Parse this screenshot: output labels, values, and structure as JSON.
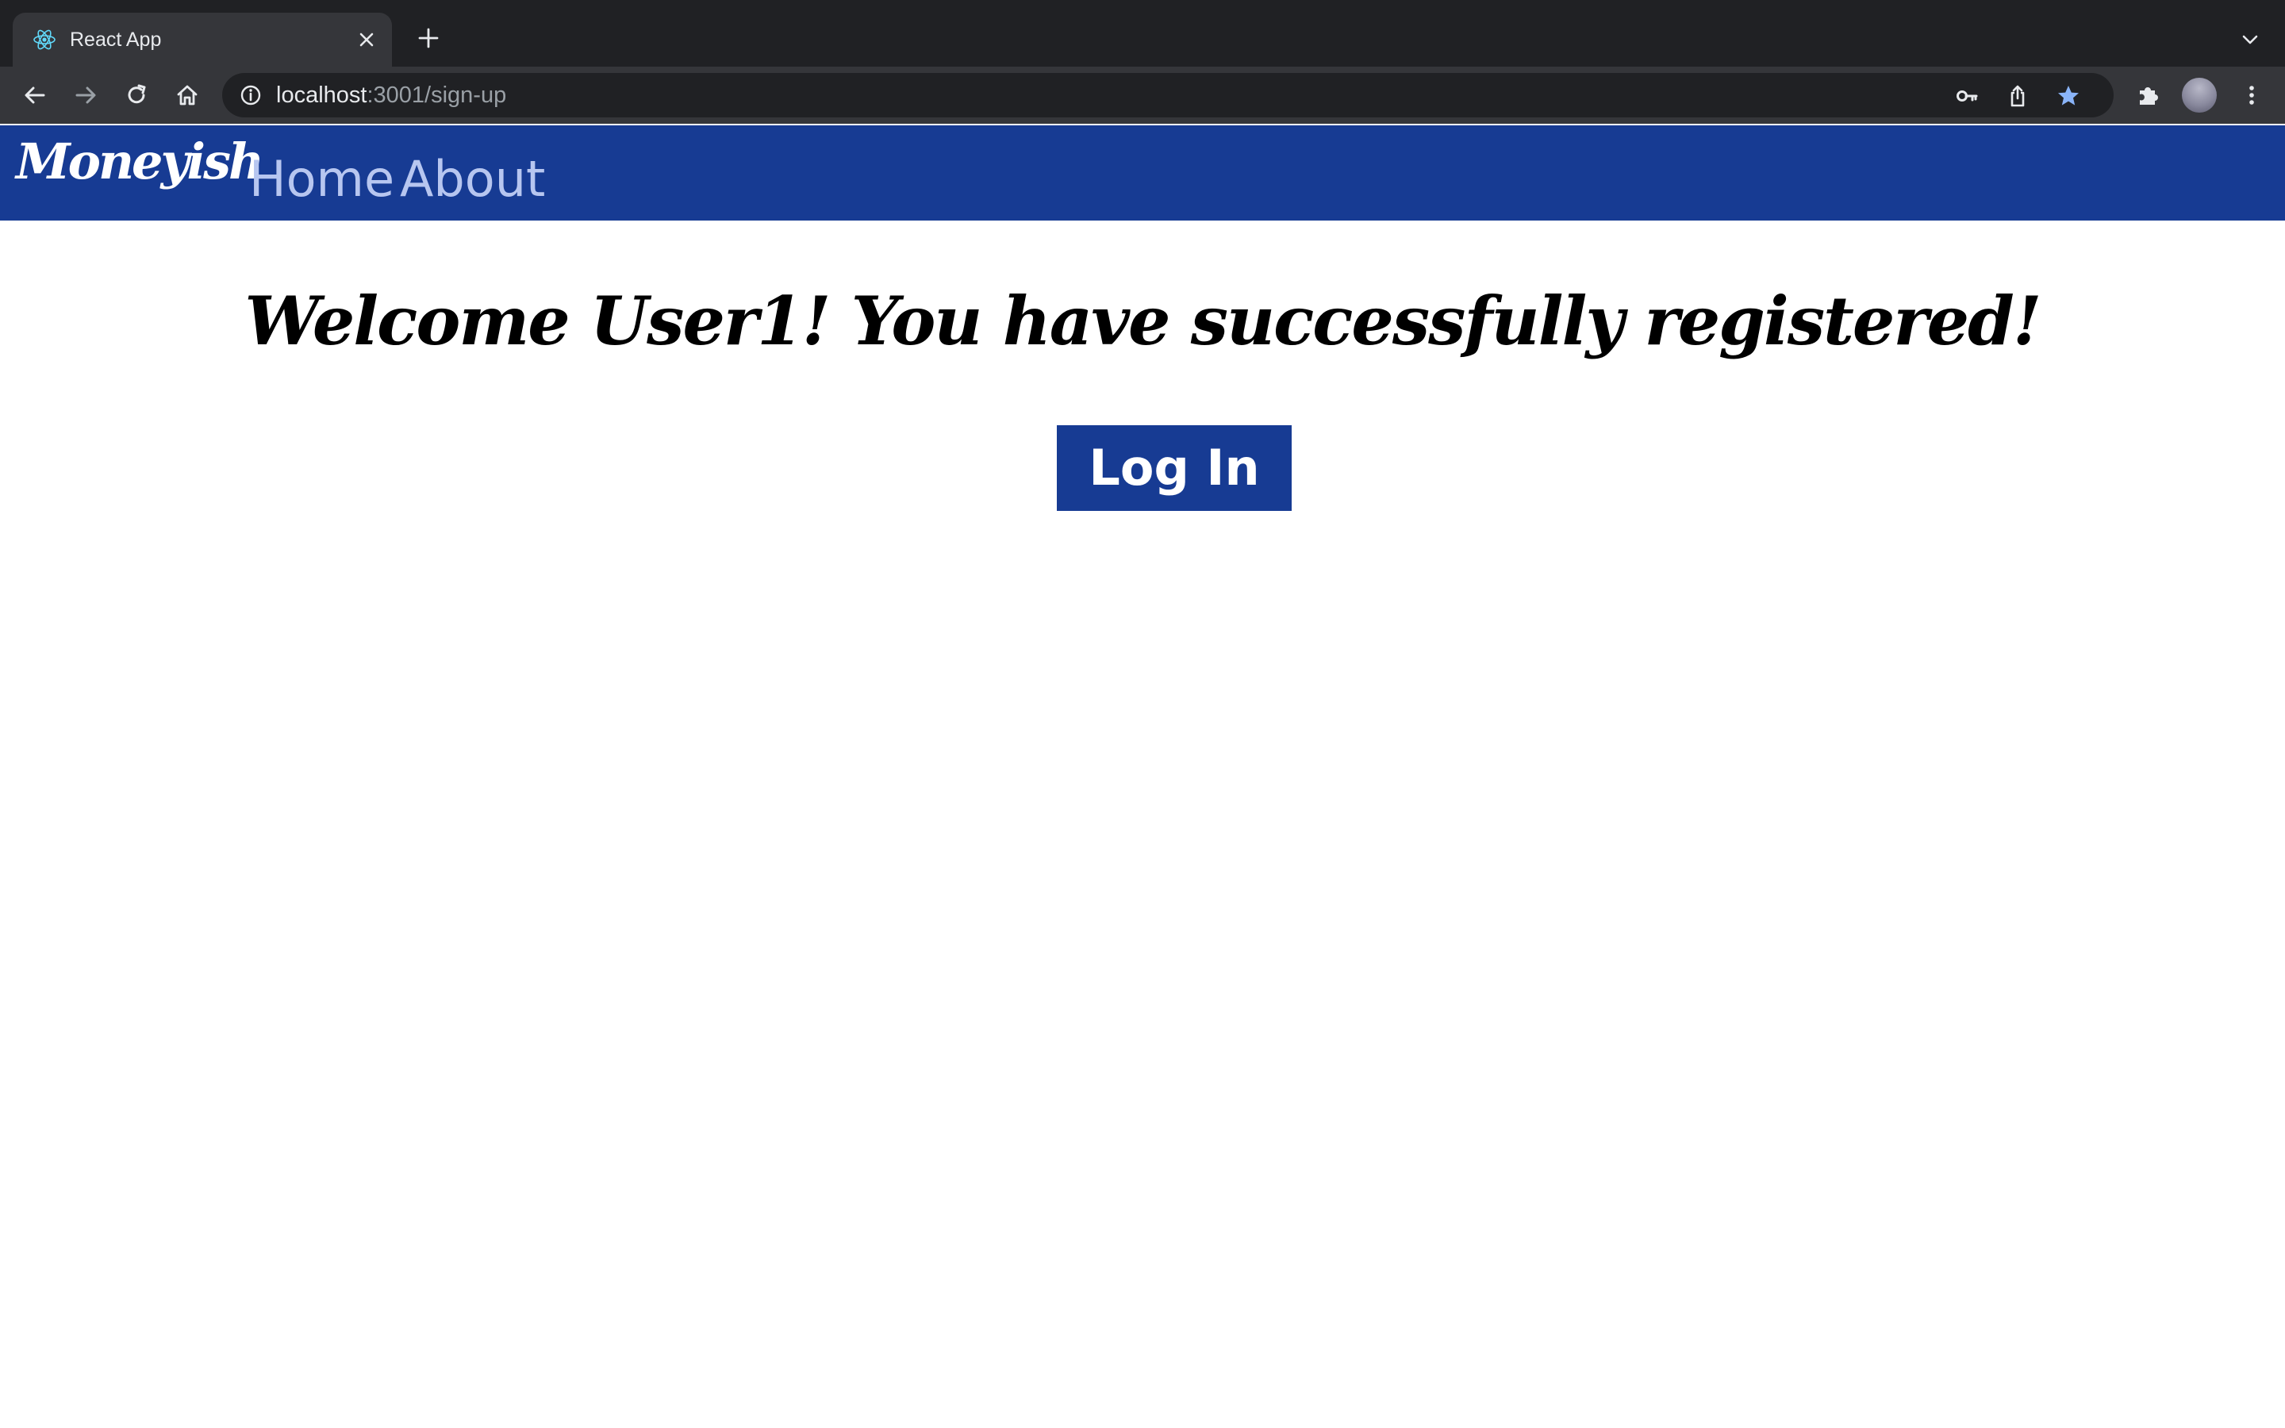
{
  "browser": {
    "tab": {
      "title": "React App",
      "favicon": "react-icon"
    },
    "url": {
      "host": "localhost",
      "rest": ":3001/sign-up"
    }
  },
  "app": {
    "brand": "Moneyish",
    "nav": [
      {
        "label": "Home"
      },
      {
        "label": "About"
      }
    ],
    "welcome_message": "Welcome User1! You have successfully registered!",
    "login_button": "Log In"
  },
  "colors": {
    "header_bg": "#173b93",
    "nav_link": "#b7c6f0",
    "bookmark_star": "#8ab4f8"
  }
}
